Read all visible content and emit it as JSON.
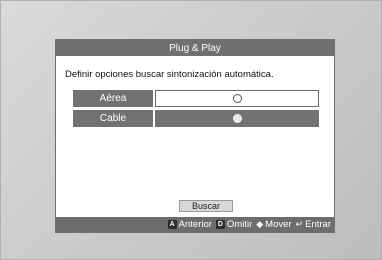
{
  "dialog": {
    "title": "Plug & Play",
    "prompt": "Definir opciones buscar sintonización automática.",
    "options": [
      {
        "label": "Aérea",
        "selected": true
      },
      {
        "label": "Cable",
        "selected": false
      }
    ],
    "search_button": "Buscar"
  },
  "footer": {
    "items": [
      {
        "key": "A",
        "label": "Anterior",
        "icon": "red-a-key-icon"
      },
      {
        "key": "D",
        "label": "Omitir",
        "icon": "blue-d-key-icon"
      },
      {
        "key": "◆",
        "label": "Mover",
        "icon": "up-down-arrow-icon"
      },
      {
        "key": "↵",
        "label": "Entrar",
        "icon": "enter-icon"
      }
    ]
  },
  "colors": {
    "dialog_bar": "#707070",
    "option_label_bg": "#727272",
    "selected_value_bg": "#ffffff"
  }
}
